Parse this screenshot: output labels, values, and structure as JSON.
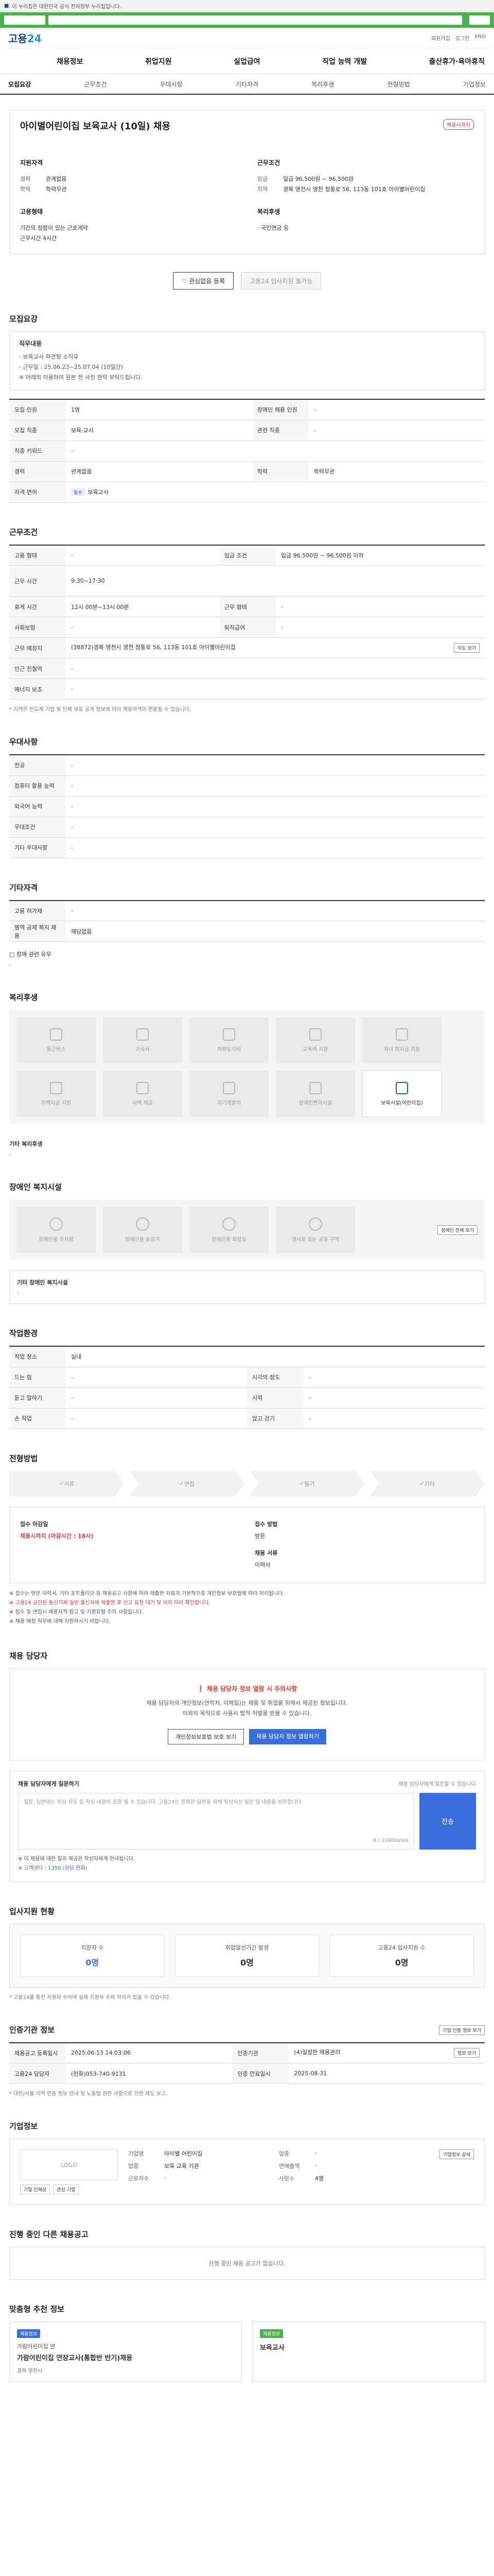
{
  "top": {
    "gov_label": "이 누리집은 대한민국 공식 전자정부 누리집입니다."
  },
  "brand": {
    "name_a": "고용",
    "name_b": "24"
  },
  "brand_links": [
    "회원가입",
    "로그인",
    "ENG"
  ],
  "gnb": [
    "채용정보",
    "취업지원",
    "실업급여",
    "직업 능력 개발",
    "출산휴가·육아휴직"
  ],
  "subtabs": [
    {
      "label": "모집요강",
      "on": true
    },
    {
      "label": "근무조건",
      "on": false
    },
    {
      "label": "우대사항",
      "on": false
    },
    {
      "label": "기타자격",
      "on": false
    },
    {
      "label": "복리후생",
      "on": false
    },
    {
      "label": "전형방법",
      "on": false
    },
    {
      "label": "기업정보",
      "on": false
    }
  ],
  "job": {
    "title": "아이별어린이집 보육교사 (10일) 채용",
    "badge": "채용시까지",
    "recruit_head": "지원자격",
    "recruit_rows": [
      {
        "k": "경력",
        "v": "관계없음"
      },
      {
        "k": "학력",
        "v": "학력무관"
      }
    ],
    "cond_head": "근무조건",
    "cond_rows": [
      {
        "k": "임금",
        "v": "일급 96,500원 ~ 96,500원"
      },
      {
        "k": "지역",
        "v": "경북 영천시 영천 청통로 56, 113동 101호 아이별어린이집"
      }
    ],
    "type_head": "고용형태",
    "type_rows": [
      {
        "k": "",
        "v": "기간의 정함이 있는 근로계약"
      },
      {
        "k": "",
        "v": "근무시간 4시간"
      }
    ],
    "welfare_head": "복리후생",
    "welfare_rows": [
      {
        "k": "",
        "v": "· 국민연금 등"
      }
    ],
    "btn_apply": "관심없음 등록",
    "btn_scrap": "고용24 입사지원 불가능"
  },
  "recruit": {
    "title": "모집요강",
    "box_head": "직무내용",
    "box_lines": [
      "- 보육교사 파견형 소직유",
      "- 근무일 : 25.06.23~25.07.04 (10일간)",
      "",
      "※ 아래의 이용하여 원본 전 사전 연락 부탁드립니다."
    ],
    "rows": [
      [
        {
          "k": "모집 인원",
          "v": "1명"
        },
        {
          "k": "장애인 채용 인원",
          "v": "-"
        }
      ],
      [
        {
          "k": "모집 직종",
          "v": "보육·교사"
        },
        {
          "k": "관련 직종",
          "v": "-"
        }
      ],
      [
        {
          "k": "직종 키워드",
          "v": "-"
        },
        {
          "k": "",
          "v": ""
        }
      ],
      [
        {
          "k": "경력",
          "v": "관계없음"
        },
        {
          "k": "학력",
          "v": "학력무관"
        }
      ],
      [
        {
          "k": "자격 면허",
          "v": "보육교사"
        },
        {
          "k": "",
          "v": ""
        }
      ]
    ],
    "license_tag": "필수"
  },
  "work": {
    "title": "근무조건",
    "rows": [
      [
        {
          "k": "고용 형태",
          "v": "-"
        },
        {
          "k": "임금 조건",
          "v": "일급 96,500원 ~ 96,500원 이하"
        }
      ],
      [
        {
          "k": "근무 시간",
          "v": "9:30~17:30"
        },
        {
          "k": "",
          "v": ""
        }
      ],
      [
        {
          "k": "휴게 시간",
          "v": "12시 00분~13시 00분"
        },
        {
          "k": "근무 형태",
          "v": "-"
        }
      ],
      [
        {
          "k": "사회보험",
          "v": "-"
        },
        {
          "k": "퇴직급여",
          "v": "-"
        }
      ],
      [
        {
          "k": "근무 예정지",
          "v": "(38872)경북 영천시 영천 청통로 56, 113동 101호 아이별어린이집"
        },
        {
          "k": "",
          "v": ""
        }
      ],
      [
        {
          "k": "인근 전철역",
          "v": "-"
        },
        {
          "k": "",
          "v": ""
        }
      ],
      [
        {
          "k": "에너지 보조",
          "v": "-"
        },
        {
          "k": "",
          "v": ""
        }
      ]
    ],
    "map_btn": "지도 보기",
    "note": "* 지역은 반도체 기업 및 단체 보유 공개 정보에 따라 채용자격이 변동될 수 있습니다."
  },
  "pref": {
    "title": "우대사항",
    "rows": [
      {
        "k": "전공",
        "v": "-"
      },
      {
        "k": "컴퓨터 활용 능력",
        "v": "-"
      },
      {
        "k": "외국어 능력",
        "v": "-"
      },
      {
        "k": "우대조건",
        "v": "-"
      },
      {
        "k": "기타 우대사항",
        "v": "-"
      }
    ]
  },
  "etc": {
    "title": "기타자격",
    "rows": [
      {
        "k": "고용 허가제",
        "v": "-"
      },
      {
        "k": "병역 공제 복지 채용",
        "v": "해당없음"
      }
    ],
    "extra_check": "□ 장애 관련 유무",
    "extra_val": "-"
  },
  "welfare": {
    "title": "복리후생",
    "items": [
      {
        "label": "통근버스",
        "on": false
      },
      {
        "label": "기숙사",
        "on": false
      },
      {
        "label": "차량유지비",
        "on": false
      },
      {
        "label": "교육비 지원",
        "on": false
      },
      {
        "label": "자녀 학자금 지원",
        "on": false
      },
      {
        "label": "주택자금 지원",
        "on": false
      },
      {
        "label": "사택 제공",
        "on": false
      },
      {
        "label": "자기계발비",
        "on": false
      },
      {
        "label": "장애인편의시설",
        "on": false
      },
      {
        "label": "보육시설(어린이집)",
        "on": true
      }
    ],
    "extra_head": "기타 복리후생",
    "extra_val": "-"
  },
  "disab": {
    "title": "장애인 복지시설",
    "items": [
      "장애인용 주차장",
      "장애인용 승강기",
      "장애인용 화장실",
      "경사로 또는 공동 구역"
    ],
    "more_btn": "장애인 전체 보기",
    "extra_head": "기타 장애인 복지시설",
    "extra_val": "-"
  },
  "envir": {
    "title": "작업환경",
    "rows": [
      [
        {
          "k": "작업 장소",
          "v": "실내"
        },
        {
          "k": "",
          "v": ""
        }
      ],
      [
        {
          "k": "드는 힘",
          "v": "-"
        },
        {
          "k": "시각의 정도",
          "v": "-"
        }
      ],
      [
        {
          "k": "듣고 말하기",
          "v": "-"
        },
        {
          "k": "시력",
          "v": "-"
        }
      ],
      [
        {
          "k": "손 작업",
          "v": "-"
        },
        {
          "k": "앉고 걷기",
          "v": "-"
        }
      ]
    ]
  },
  "process": {
    "title": "전형방법",
    "steps": [
      "서류",
      "면접",
      "필기",
      "기타"
    ],
    "recv_h1": "접수 마감일",
    "recv_v1": "채용시까지 (마감시간 : 18시)",
    "recv_h2": "접수 방법",
    "recv_v2": "방문",
    "recv_h3": "채용 서류",
    "recv_v3": "이력서",
    "bullets": [
      "※ 접수는 방문 이력서, 기타 포트폴리오 등 채용공고 사항에 따라 제출한 자료가 기본적으로 개인정보 보호법에 따라 처리됩니다.",
      "※ 고용24 공인된 통신기재 일반 출신자에 제출한 후 신고 요청 대기 및 비의 따라 확인합니다.",
      "※ 접수 및 면접시 채용자격 참고 및 지원유형 주의 사항입니다.",
      "※ 채용 예정 직무에 대해 지원하시기 바랍니다."
    ]
  },
  "contact": {
    "title": "채용 담당자",
    "warn": "채용 담당자 정보 열람 시 주의사항",
    "desc1": "채용 담당자의 개인정보(연락처, 이메일)는 채용 및 취업을 위해서 제공된 정보입니다.",
    "desc2": "이외의 목적으로 사용시 법적 처벌을 받을 수 있습니다.",
    "btn1": "개인정보보호법 보호 보기",
    "btn2": "채용 담당자 정보 열람하기"
  },
  "qna": {
    "head": "채용 담당자에게 질문하기",
    "hint": "채용 담당자에게 질문할 수 있습니다",
    "placeholder": "질문, 답변에는 작성 자유 등 작성 내용이 포함 될 수 있습니다. 고용24는 정확한 답변을 위해 작성하신 질문 및 내용을 보관합니다.",
    "count": "0 / 1000bytes",
    "send": "전송",
    "note1": "※ 이 채용에 대한 질의 제공은 작성자에게 안내됩니다.",
    "note2": "※ 고객센터 : 1350 (상담 전화)"
  },
  "stats": {
    "title": "입사지원 현황",
    "items": [
      {
        "label": "지원자 수",
        "value": "0명"
      },
      {
        "label": "취업알선기간 발생",
        "value": "0명"
      },
      {
        "label": "고용24 입사지원 수",
        "value": "0명"
      }
    ],
    "note": "* 고용24를 통한 지원자 수이며 실제 지원자 수와 차이가 있을 수 있습니다."
  },
  "info": {
    "title": "인증기관 정보",
    "more": "기업 인증 정보 보기",
    "rows": [
      [
        {
          "k": "채용공고 등록일시",
          "v": "2025.06.13 14:03:06"
        },
        {
          "k": "인증기관",
          "v": "(4)일정한 채용관리",
          "btn": "정보 보기"
        }
      ],
      [
        {
          "k": "고용24 담당자",
          "v": "(전화)053-740-9131"
        },
        {
          "k": "인증 만료일시",
          "v": "2025-08-31"
        }
      ]
    ],
    "note": "* 대전/서울 지역 인증 정보 안내 및 노동법 관련 사항으로 인한 제도 보고."
  },
  "company": {
    "title": "기업정보",
    "logo": "LOGO",
    "mb1": "기업 인재상",
    "mb2": "관심 기업",
    "cells": [
      {
        "k": "기업명",
        "v": "아이별 어린이집"
      },
      {
        "k": "업종",
        "v": "-"
      },
      {
        "k": "업종",
        "v": "보육 교육 기관"
      },
      {
        "k": "연매출액",
        "v": "-"
      },
      {
        "k": "근로자수",
        "v": "-"
      },
      {
        "k": "사원수",
        "v": "4명"
      }
    ],
    "btn": "기업정보 상세"
  },
  "related": {
    "title": "진행 중인 다른 채용공고",
    "empty": "진행 중인 채용 공고가 없습니다."
  },
  "recommend": {
    "title": "맞춤형 추천 정보",
    "cards": [
      {
        "tag": "채용정보",
        "co": "가람어린이집 연",
        "name": "가람어린이집 연장교사(통합반 반기)채용",
        "loc": "경북 영천시"
      },
      {
        "tag": "채용정보",
        "co": "",
        "name": "보육교사",
        "loc": ""
      }
    ]
  }
}
